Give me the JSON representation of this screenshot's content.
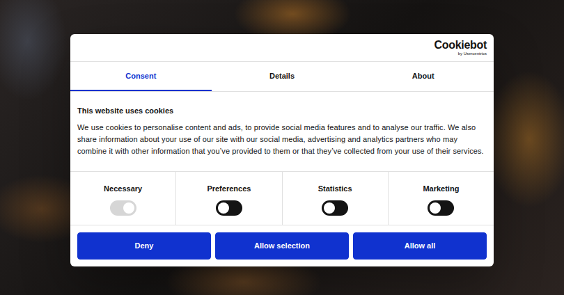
{
  "logo": {
    "text": "Cookiebot",
    "subtext": "by Usercentrics"
  },
  "tabs": [
    {
      "label": "Consent",
      "selected": true
    },
    {
      "label": "Details",
      "selected": false
    },
    {
      "label": "About",
      "selected": false
    }
  ],
  "heading": "This website uses cookies",
  "body": "We use cookies to personalise content and ads, to provide social media features and to analyse our traffic. We also share information about your use of our site with our social media, advertising and analytics partners who may combine it with other information that you’ve provided to them or that they’ve collected from your use of their services.",
  "categories": [
    {
      "label": "Necessary",
      "checked": true,
      "disabled": true
    },
    {
      "label": "Preferences",
      "checked": false,
      "disabled": false
    },
    {
      "label": "Statistics",
      "checked": false,
      "disabled": false
    },
    {
      "label": "Marketing",
      "checked": false,
      "disabled": false
    }
  ],
  "buttons": [
    "Deny",
    "Allow selection",
    "Allow all"
  ]
}
